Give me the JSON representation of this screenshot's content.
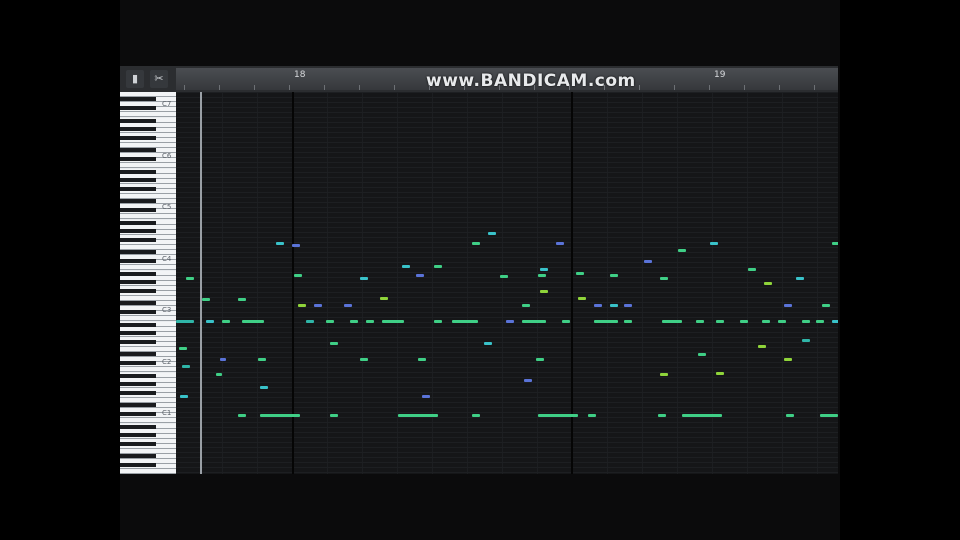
{
  "watermark": "www.BANDICAM.com",
  "toolbar": {
    "tool_a_icon": "pencil-icon",
    "tool_b_icon": "scissors-icon"
  },
  "ruler": {
    "bar_18": "18",
    "bar_19": "19"
  },
  "keyboard": {
    "octaves": [
      "C7",
      "C6",
      "C5",
      "C4",
      "C3",
      "C2",
      "C1"
    ]
  },
  "colors": {
    "background": "#131416",
    "note_green": "#3fcf86",
    "note_lime": "#8fd43a",
    "note_teal": "#2fb5a8",
    "note_blue": "#5a73d8",
    "note_cyan": "#39c2c9"
  }
}
